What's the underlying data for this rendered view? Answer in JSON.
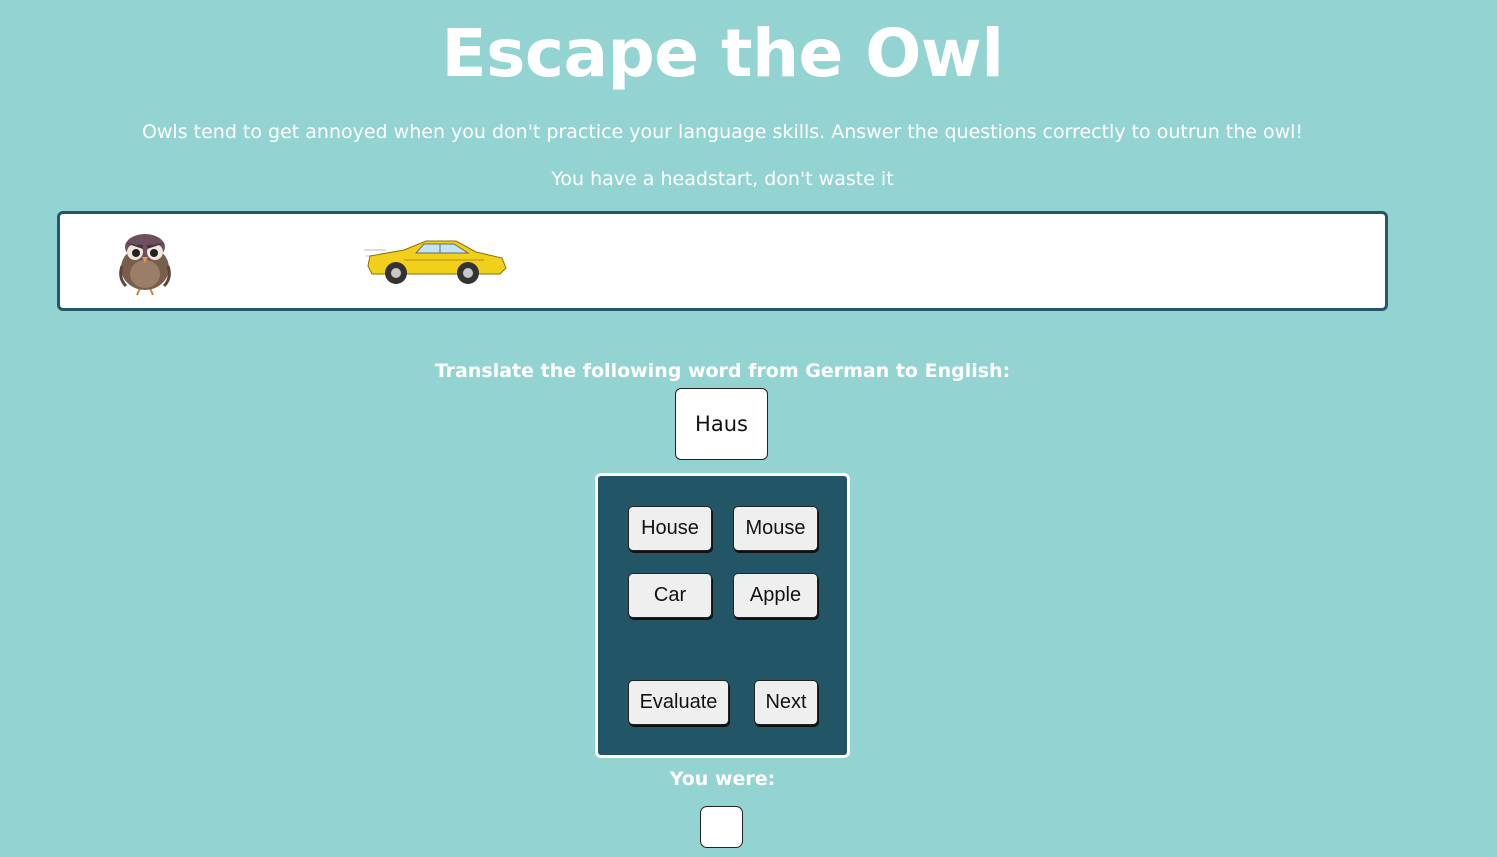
{
  "header": {
    "title": "Escape the Owl",
    "intro": "Owls tend to get annoyed when you don't practice your language skills. Answer the questions correctly to outrun the owl!",
    "headstart": "You have a headstart, don't waste it"
  },
  "race": {
    "owl_icon": "angry-owl-icon",
    "car_icon": "yellow-sports-car-icon"
  },
  "quiz": {
    "prompt": "Translate the following word from German to English:",
    "word": "Haus",
    "options": [
      "House",
      "Mouse",
      "Car",
      "Apple"
    ],
    "evaluate_label": "Evaluate",
    "next_label": "Next"
  },
  "result": {
    "label": "You were:",
    "value": ""
  },
  "colors": {
    "background": "#93d4d2",
    "panel": "#225566",
    "track_border": "#235866"
  }
}
